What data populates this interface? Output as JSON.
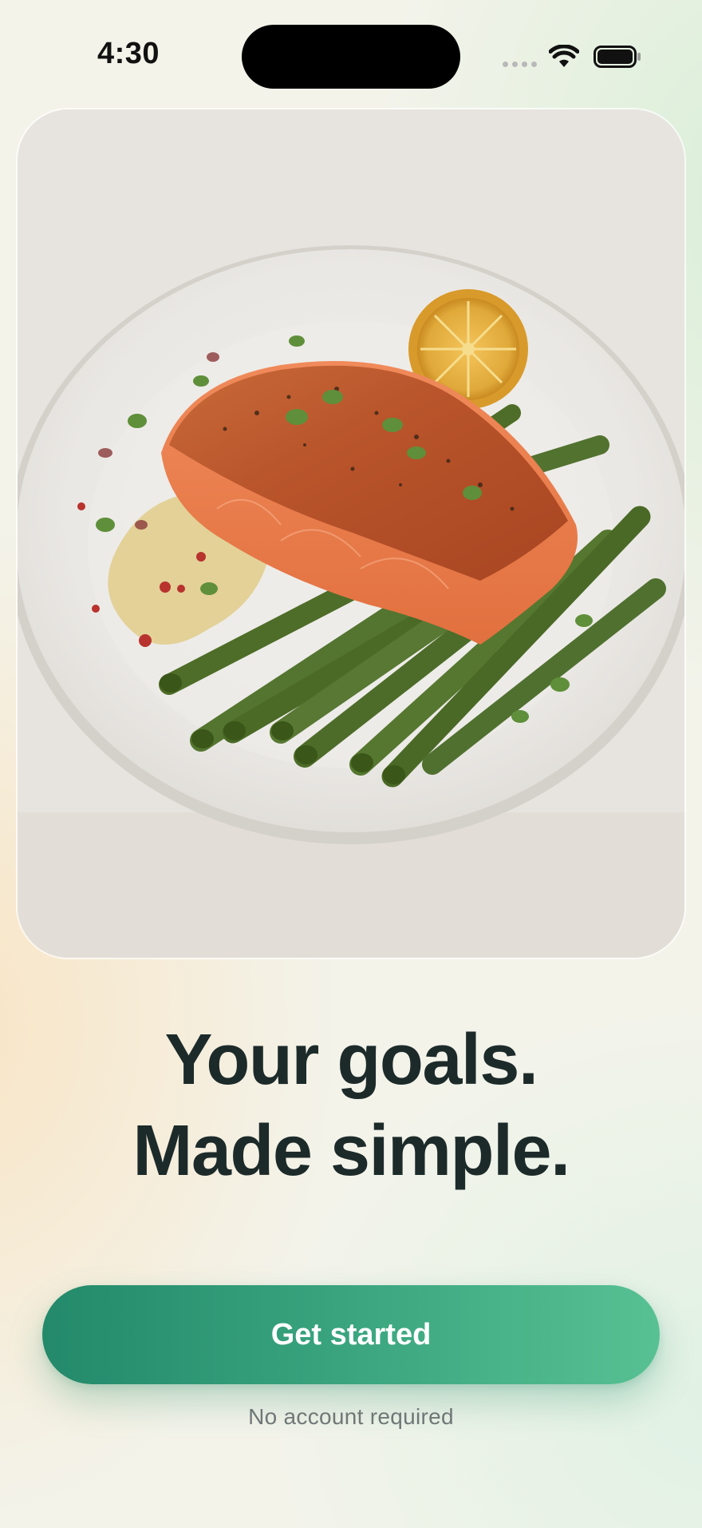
{
  "status_bar": {
    "time": "4:30"
  },
  "hero": {
    "image_subject": "seared salmon fillet with asparagus and lemon on a white plate",
    "icon": "food-photo"
  },
  "headline": {
    "line1": "Your goals.",
    "line2": "Made simple."
  },
  "cta": {
    "label": "Get started",
    "subnote": "No account required"
  },
  "colors": {
    "headline": "#1c2a2a",
    "cta_start": "#23896a",
    "cta_end": "#58c193",
    "subnote": "#6f7777"
  }
}
